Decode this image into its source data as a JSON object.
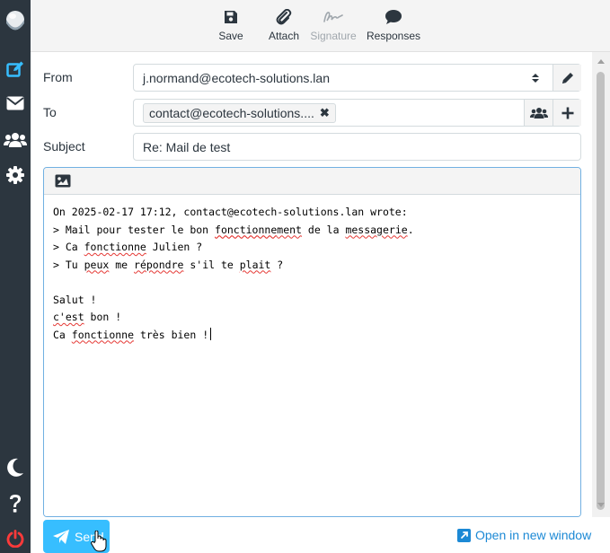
{
  "colors": {
    "nav_bg": "#2c363f",
    "accent": "#37beff",
    "link": "#1c89d5",
    "text": "#2c363f",
    "spell_error": "#e53935"
  },
  "nav": {
    "items": [
      {
        "name": "compose",
        "icon": "compose-icon",
        "active": true
      },
      {
        "name": "mail",
        "icon": "envelope-icon"
      },
      {
        "name": "contacts",
        "icon": "users-icon"
      },
      {
        "name": "settings",
        "icon": "gear-icon"
      }
    ],
    "bottom": [
      {
        "name": "dark-mode",
        "icon": "moon-icon"
      },
      {
        "name": "help",
        "icon": "question-icon"
      },
      {
        "name": "logout",
        "icon": "power-icon"
      }
    ]
  },
  "toolbar": {
    "save_label": "Save",
    "attach_label": "Attach",
    "signature_label": "Signature",
    "responses_label": "Responses"
  },
  "form": {
    "from_label": "From",
    "from_value": "j.normand@ecotech-solutions.lan",
    "to_label": "To",
    "to_recipients": [
      "contact@ecotech-solutions...."
    ],
    "remove_glyph": "✖",
    "subject_label": "Subject",
    "subject_value": "Re: Mail de test"
  },
  "editor": {
    "lines": [
      "On 2025-02-17 17:12, contact@ecotech-solutions.lan wrote:",
      "> Mail pour tester le bon fonctionnement de la messagerie.",
      "> Ca fonctionne Julien ?",
      "> Tu peux me répondre s'il te plait ?",
      "",
      "Salut !",
      "c'est bon !",
      "Ca fonctionne très bien !"
    ]
  },
  "footer": {
    "send_label": "Send",
    "open_new_window_label": "Open in new window"
  }
}
